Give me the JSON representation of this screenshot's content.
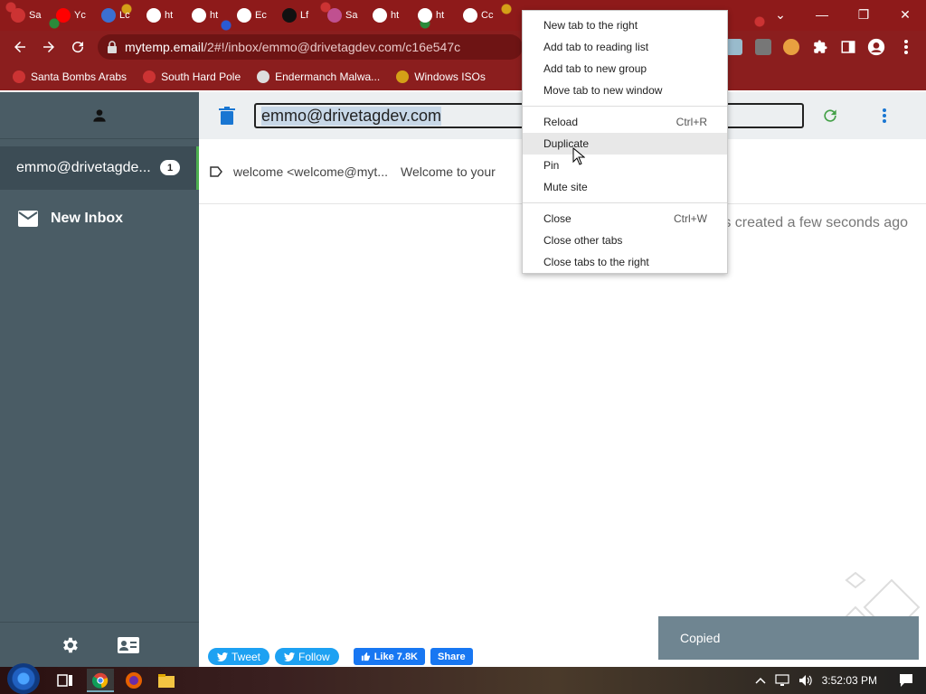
{
  "browser": {
    "tabs": [
      {
        "label": "Sa",
        "color": "#c33"
      },
      {
        "label": "Yc",
        "color": "#f00"
      },
      {
        "label": "Lc",
        "color": "#3b6fd1"
      },
      {
        "label": "ht",
        "color": "#fff"
      },
      {
        "label": "ht",
        "color": "#fff"
      },
      {
        "label": "Ec",
        "color": "#fff"
      },
      {
        "label": "Lf",
        "color": "#111"
      },
      {
        "label": "Sa",
        "color": "#c05090"
      },
      {
        "label": "ht",
        "color": "#fff"
      },
      {
        "label": "ht",
        "color": "#fff"
      },
      {
        "label": "Cc",
        "color": "#fff"
      }
    ],
    "url_host": "mytemp.email",
    "url_path": "/2#!/inbox/emmo@drivetagdev.com/c16e547c",
    "bookmarks": [
      {
        "label": "Santa Bombs Arabs",
        "color": "#c33"
      },
      {
        "label": "South Hard Pole",
        "color": "#c33"
      },
      {
        "label": "Endermanch Malwa...",
        "color": "#ddd"
      },
      {
        "label": "Windows ISOs",
        "color": "#d4a017"
      }
    ],
    "window_controls": {
      "tabsearch": "⌄",
      "minimize": "—",
      "restore": "❐",
      "close": "✕"
    }
  },
  "context_menu": {
    "items": [
      {
        "label": "New tab to the right",
        "shortcut": ""
      },
      {
        "label": "Add tab to reading list",
        "shortcut": ""
      },
      {
        "label": "Add tab to new group",
        "shortcut": ""
      },
      {
        "label": "Move tab to new window",
        "shortcut": ""
      },
      {
        "label": "Reload",
        "shortcut": "Ctrl+R"
      },
      {
        "label": "Duplicate",
        "shortcut": ""
      },
      {
        "label": "Pin",
        "shortcut": ""
      },
      {
        "label": "Mute site",
        "shortcut": ""
      },
      {
        "label": "Close",
        "shortcut": "Ctrl+W"
      },
      {
        "label": "Close other tabs",
        "shortcut": ""
      },
      {
        "label": "Close tabs to the right",
        "shortcut": ""
      }
    ]
  },
  "app": {
    "current_address": "emmo@drivetagdev.com",
    "sidebar": {
      "inbox_label": "emmo@drivetagde...",
      "inbox_count": "1",
      "new_inbox_label": "New Inbox"
    },
    "message": {
      "from": "welcome <welcome@myt...",
      "subject": "Welcome to your"
    },
    "created_text": "s created a few seconds ago",
    "toast": "Copied",
    "social": {
      "tweet": "Tweet",
      "follow": "Follow",
      "like": "Like 7.8K",
      "share": "Share"
    }
  },
  "taskbar": {
    "time": "3:52:03 PM"
  }
}
